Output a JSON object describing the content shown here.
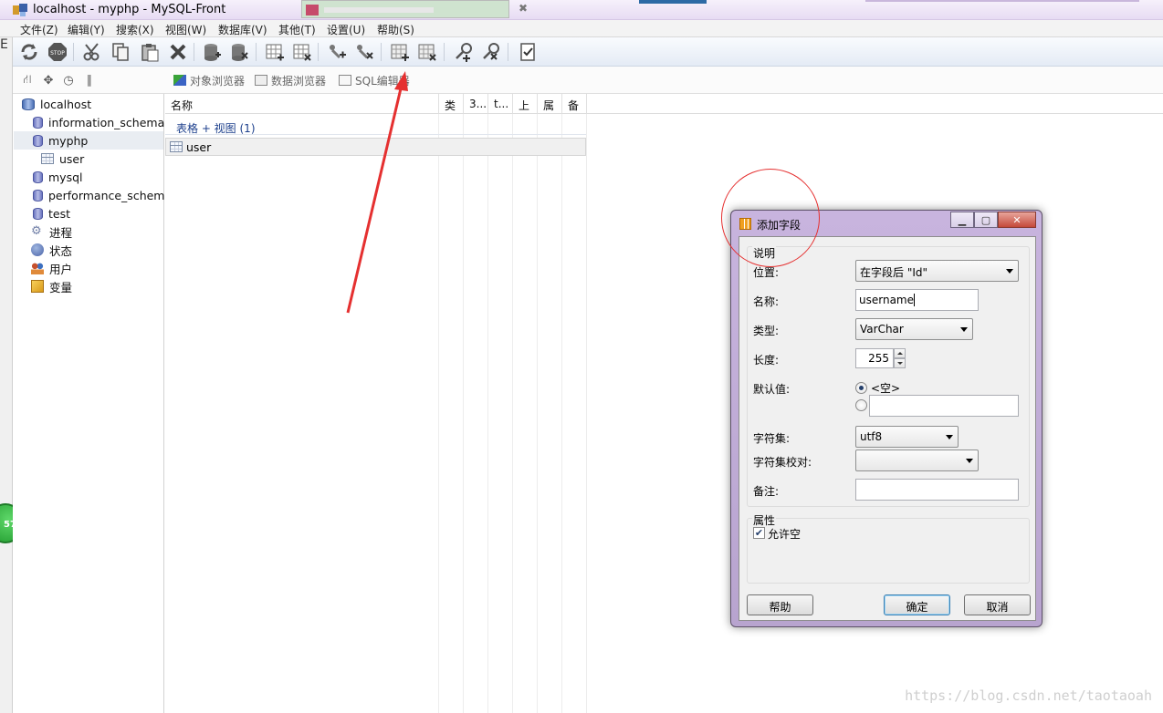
{
  "window": {
    "title": "localhost - myphp - MySQL-Front"
  },
  "menu": [
    "文件(Z)",
    "编辑(Y)",
    "搜索(X)",
    "视图(W)",
    "数据库(V)",
    "其他(T)",
    "设置(U)",
    "帮助(S)"
  ],
  "view_tabs": [
    "对象浏览器",
    "数据浏览器",
    "SQL编辑器"
  ],
  "tree": {
    "server": "localhost",
    "items": [
      {
        "label": "information_schema",
        "kind": "db-search"
      },
      {
        "label": "myphp",
        "kind": "db",
        "selected": true
      },
      {
        "label": "user",
        "kind": "table",
        "indent": 2
      },
      {
        "label": "mysql",
        "kind": "db"
      },
      {
        "label": "performance_schema",
        "kind": "db-search"
      },
      {
        "label": "test",
        "kind": "db"
      },
      {
        "label": "进程",
        "kind": "process"
      },
      {
        "label": "状态",
        "kind": "status"
      },
      {
        "label": "用户",
        "kind": "users"
      },
      {
        "label": "变量",
        "kind": "variables"
      }
    ]
  },
  "list": {
    "columns": [
      "名称",
      "类",
      "3...",
      "t...",
      "上",
      "属",
      "备"
    ],
    "group_label": "表格 + 视图 (1)",
    "rows": [
      "user"
    ]
  },
  "dialog": {
    "title": "添加字段",
    "section_desc": "说明",
    "position_label": "位置:",
    "position_value": "在字段后 \"Id\"",
    "name_label": "名称:",
    "name_value": "username",
    "type_label": "类型:",
    "type_value": "VarChar",
    "length_label": "长度:",
    "length_value": "255",
    "default_label": "默认值:",
    "default_empty_option": "<空>",
    "charset_label": "字符集:",
    "charset_value": "utf8",
    "collation_label": "字符集校对:",
    "collation_value": "",
    "comment_label": "备注:",
    "comment_value": "",
    "section_attr": "属性",
    "allow_null_label": "允许空",
    "help_button": "帮助",
    "ok_button": "确定",
    "cancel_button": "取消"
  },
  "left_badge": "57",
  "left_edge_marker": "E",
  "watermark": "https://blog.csdn.net/taotaoah",
  "colors": {
    "annotation_red": "#e53030",
    "dialog_frame": "#c8b4de",
    "link_blue": "#1c3f8c"
  }
}
